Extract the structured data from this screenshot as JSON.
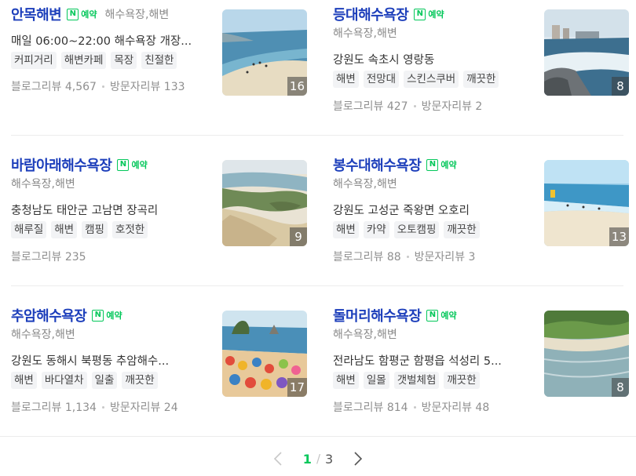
{
  "reserve_badge": "예약",
  "reserve_badge_icon": "naver-n-icon",
  "pagination": {
    "current": "1",
    "separator": "/",
    "total": "3"
  },
  "places": [
    {
      "name": "안목해변",
      "category": "해수욕장,해변",
      "category_inline": true,
      "desc": "매일 06:00~22:00 해수욕장 개장...",
      "tags": [
        "커피거리",
        "해변카페",
        "목장",
        "친절한"
      ],
      "blog_review": "블로그리뷰 4,567",
      "visitor_review": "방문자리뷰 133",
      "photo_count": "16"
    },
    {
      "name": "등대해수욕장",
      "category": "해수욕장,해변",
      "category_inline": false,
      "desc": "강원도 속초시 영랑동",
      "tags": [
        "해변",
        "전망대",
        "스킨스쿠버",
        "깨끗한"
      ],
      "blog_review": "블로그리뷰 427",
      "visitor_review": "방문자리뷰 2",
      "photo_count": "8"
    },
    {
      "name": "바람아래해수욕장",
      "category": "해수욕장,해변",
      "category_inline": false,
      "desc": "충청남도 태안군 고남면 장곡리",
      "tags": [
        "해루질",
        "해변",
        "캠핑",
        "호젓한"
      ],
      "blog_review": "블로그리뷰 235",
      "visitor_review": "",
      "photo_count": "9"
    },
    {
      "name": "봉수대해수욕장",
      "category": "해수욕장,해변",
      "category_inline": false,
      "desc": "강원도 고성군 죽왕면 오호리",
      "tags": [
        "해변",
        "카약",
        "오토캠핑",
        "깨끗한"
      ],
      "blog_review": "블로그리뷰 88",
      "visitor_review": "방문자리뷰 3",
      "photo_count": "13"
    },
    {
      "name": "추암해수욕장",
      "category": "해수욕장,해변",
      "category_inline": false,
      "desc": "강원도 동해시 북평동 추암해수...",
      "tags": [
        "해변",
        "바다열차",
        "일출",
        "깨끗한"
      ],
      "blog_review": "블로그리뷰 1,134",
      "visitor_review": "방문자리뷰 24",
      "photo_count": "17"
    },
    {
      "name": "돌머리해수욕장",
      "category": "해수욕장,해변",
      "category_inline": false,
      "desc": "전라남도 함평군 함평읍 석성리 5...",
      "tags": [
        "해변",
        "일몰",
        "갯벌체험",
        "깨끗한"
      ],
      "blog_review": "블로그리뷰 814",
      "visitor_review": "방문자리뷰 48",
      "photo_count": "8"
    }
  ]
}
